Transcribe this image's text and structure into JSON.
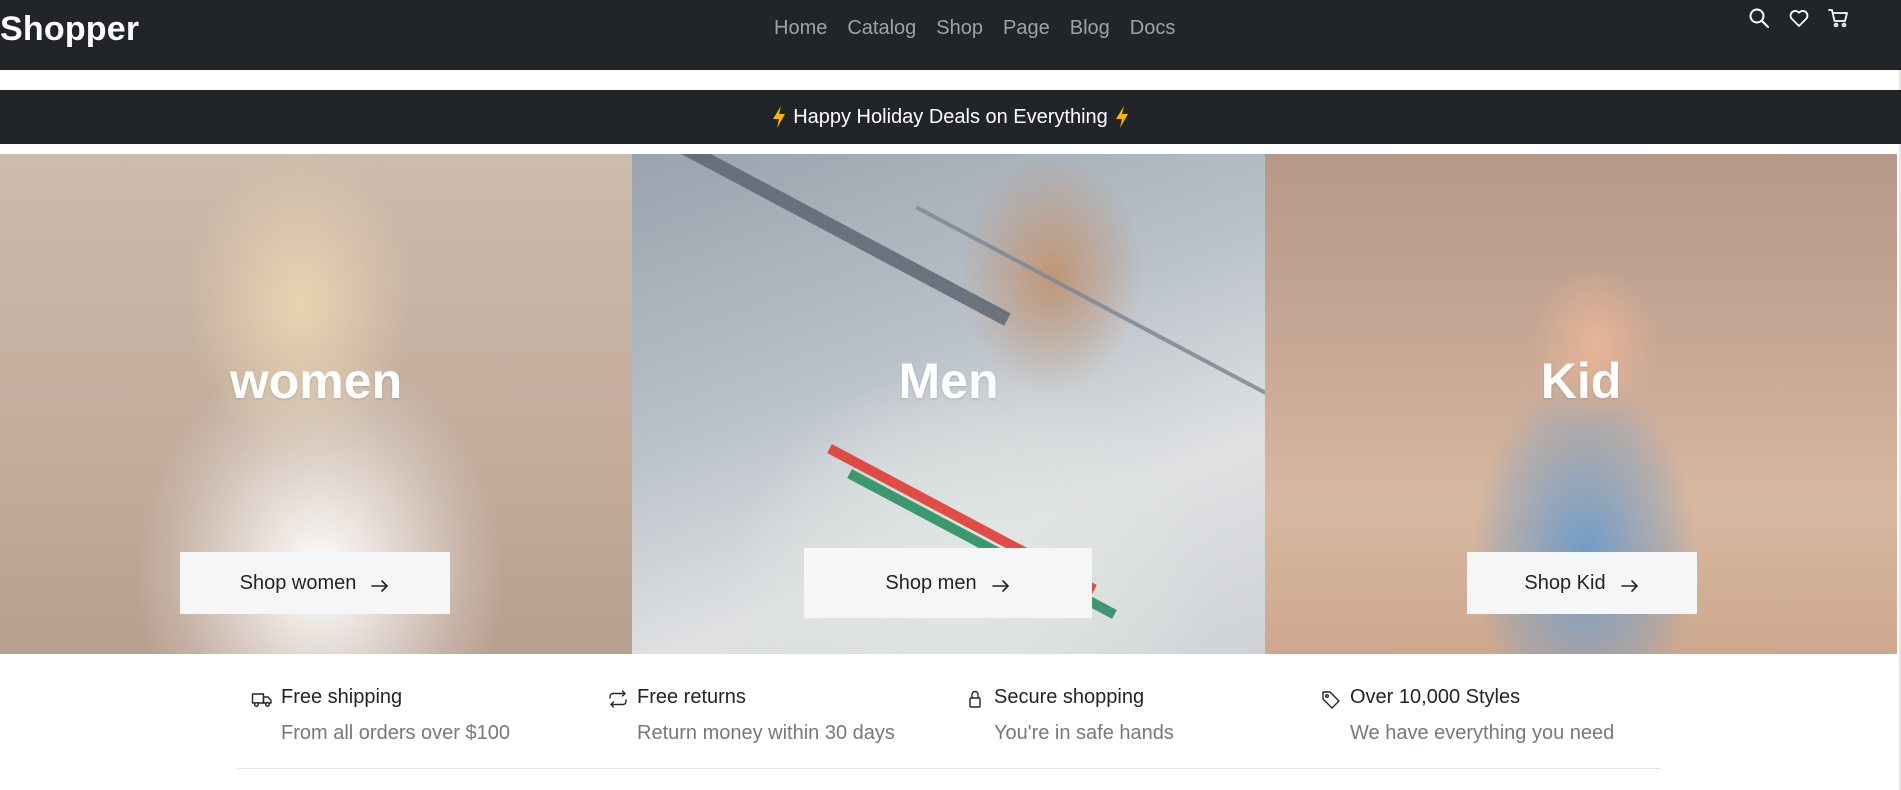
{
  "navbar": {
    "brand": "Shopper",
    "links": [
      "Home",
      "Catalog",
      "Shop",
      "Page",
      "Blog",
      "Docs"
    ],
    "icons": [
      "search-icon",
      "heart-icon",
      "cart-icon"
    ]
  },
  "promo": {
    "text": "Happy Holiday Deals on Everything",
    "icon": "lightning-icon",
    "accent": "#f5b70a"
  },
  "hero": {
    "panels": [
      {
        "title": "women",
        "button": "Shop women"
      },
      {
        "title": "Men",
        "button": "Shop men"
      },
      {
        "title": "Kid",
        "button": "Shop Kid"
      }
    ]
  },
  "features": [
    {
      "icon": "truck-icon",
      "title": "Free shipping",
      "subtitle": "From all orders over $100"
    },
    {
      "icon": "repeat-icon",
      "title": "Free returns",
      "subtitle": "Return money within 30 days"
    },
    {
      "icon": "lock-icon",
      "title": "Secure shopping",
      "subtitle": "You're in safe hands"
    },
    {
      "icon": "tag-icon",
      "title": "Over 10,000 Styles",
      "subtitle": "We have everything you need"
    }
  ],
  "colors": {
    "navbar_bg": "#212529",
    "nav_link": "#9ea3a8",
    "button_bg": "#f4f6f8",
    "muted_text": "#727980"
  }
}
